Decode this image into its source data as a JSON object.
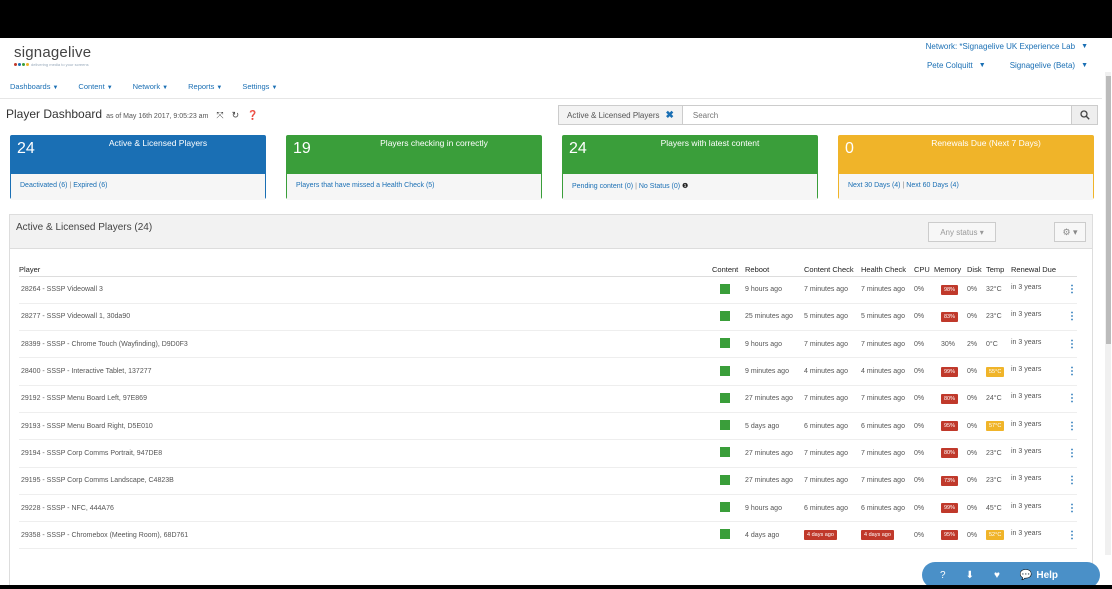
{
  "brand": {
    "name": "signagelive",
    "tagline": "delivering media to your screens"
  },
  "header": {
    "network_label": "Network: *Signagelive UK Experience Lab",
    "user": "Pete Colquitt",
    "product": "Signagelive (Beta)"
  },
  "nav": [
    "Dashboards",
    "Content",
    "Network",
    "Reports",
    "Settings"
  ],
  "page": {
    "title": "Player Dashboard",
    "subtitle": "as of May 16th 2017, 9:05:23 am"
  },
  "filter": {
    "chip": "Active & Licensed Players",
    "placeholder": "Search"
  },
  "cards": [
    {
      "count": "24",
      "label": "Active & Licensed Players",
      "links": [
        "Deactivated (6)",
        "Expired (6)"
      ]
    },
    {
      "count": "19",
      "label": "Players checking in correctly",
      "links": [
        "Players that have missed a Health Check (5)"
      ]
    },
    {
      "count": "24",
      "label": "Players with latest content",
      "links": [
        "Pending content (0)",
        "No Status (0)"
      ]
    },
    {
      "count": "0",
      "label": "Renewals Due (Next 7 Days)",
      "links": [
        "Next 30 Days (4)",
        "Next 60 Days (4)"
      ]
    }
  ],
  "panel": {
    "title": "Active & Licensed Players (24)",
    "status_filter": "Any status"
  },
  "table": {
    "headers": [
      "Player",
      "Content",
      "Reboot",
      "Content Check",
      "Health Check",
      "CPU",
      "Memory",
      "Disk",
      "Temp",
      "Renewal Due"
    ],
    "rows": [
      {
        "player": "28264 - SSSP Videowall 3",
        "reboot": "9 hours ago",
        "content_check": "7 minutes ago",
        "health_check": "7 minutes ago",
        "cpu": "0%",
        "memory": "98%",
        "memory_badge": true,
        "disk": "0%",
        "temp": "32°C",
        "temp_badge": false,
        "renewal": "in 3 years"
      },
      {
        "player": "28277 - SSSP Videowall 1, 30da90",
        "reboot": "25 minutes ago",
        "content_check": "5 minutes ago",
        "health_check": "5 minutes ago",
        "cpu": "0%",
        "memory": "83%",
        "memory_badge": true,
        "disk": "0%",
        "temp": "23°C",
        "temp_badge": false,
        "renewal": "in 3 years"
      },
      {
        "player": "28399 - SSSP - Chrome Touch (Wayfinding), D9D0F3",
        "reboot": "9 hours ago",
        "content_check": "7 minutes ago",
        "health_check": "7 minutes ago",
        "cpu": "0%",
        "memory": "30%",
        "memory_badge": false,
        "disk": "2%",
        "temp": "0°C",
        "temp_badge": false,
        "renewal": "in 3 years"
      },
      {
        "player": "28400 - SSSP - Interactive Tablet, 137277",
        "reboot": "9 minutes ago",
        "content_check": "4 minutes ago",
        "health_check": "4 minutes ago",
        "cpu": "0%",
        "memory": "99%",
        "memory_badge": true,
        "disk": "0%",
        "temp": "55°C",
        "temp_badge": true,
        "renewal": "in 3 years"
      },
      {
        "player": "29192 - SSSP Menu Board Left, 97E869",
        "reboot": "27 minutes ago",
        "content_check": "7 minutes ago",
        "health_check": "7 minutes ago",
        "cpu": "0%",
        "memory": "80%",
        "memory_badge": true,
        "disk": "0%",
        "temp": "24°C",
        "temp_badge": false,
        "renewal": "in 3 years"
      },
      {
        "player": "29193 - SSSP Menu Board Right, D5E010",
        "reboot": "5 days ago",
        "content_check": "6 minutes ago",
        "health_check": "6 minutes ago",
        "cpu": "0%",
        "memory": "95%",
        "memory_badge": true,
        "disk": "0%",
        "temp": "57°C",
        "temp_badge": true,
        "renewal": "in 3 years"
      },
      {
        "player": "29194 - SSSP Corp Comms Portrait, 947DE8",
        "reboot": "27 minutes ago",
        "content_check": "7 minutes ago",
        "health_check": "7 minutes ago",
        "cpu": "0%",
        "memory": "80%",
        "memory_badge": true,
        "disk": "0%",
        "temp": "23°C",
        "temp_badge": false,
        "renewal": "in 3 years"
      },
      {
        "player": "29195 - SSSP Corp Comms Landscape, C4823B",
        "reboot": "27 minutes ago",
        "content_check": "7 minutes ago",
        "health_check": "7 minutes ago",
        "cpu": "0%",
        "memory": "73%",
        "memory_badge": true,
        "disk": "0%",
        "temp": "23°C",
        "temp_badge": false,
        "renewal": "in 3 years"
      },
      {
        "player": "29228 - SSSP - NFC, 444A76",
        "reboot": "9 hours ago",
        "content_check": "6 minutes ago",
        "health_check": "6 minutes ago",
        "cpu": "0%",
        "memory": "99%",
        "memory_badge": true,
        "disk": "0%",
        "temp": "45°C",
        "temp_badge": false,
        "renewal": "in 3 years"
      },
      {
        "player": "29358 - SSSP - Chromebox (Meeting Room), 68D761",
        "reboot": "4 days ago",
        "content_check": "4 days ago",
        "health_check": "4 days ago",
        "check_badge": true,
        "cpu": "0%",
        "memory": "95%",
        "memory_badge": true,
        "disk": "0%",
        "temp": "52°C",
        "temp_badge": true,
        "renewal": "in 3 years"
      }
    ]
  },
  "help": {
    "label": "Help"
  },
  "colors": {
    "blue": "#1a6fb4",
    "green": "#3a9e3a",
    "amber": "#f0b429",
    "red": "#c0392b"
  }
}
